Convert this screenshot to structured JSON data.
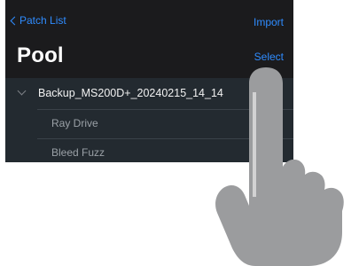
{
  "nav": {
    "back_label": "Patch List",
    "import_label": "Import"
  },
  "header": {
    "title": "Pool",
    "select_label": "Select"
  },
  "list": {
    "group": {
      "label": "Backup_MS200D+_20240215_14_14",
      "expanded": true
    },
    "items": [
      {
        "label": "Ray Drive"
      },
      {
        "label": "Bleed Fuzz"
      }
    ]
  },
  "colors": {
    "accent": "#2f8cff",
    "background": "#1b1b1d",
    "list_background": "#232a30",
    "hand": "#9b9c9e"
  },
  "overlay": {
    "icon": "pointing-hand-icon"
  }
}
